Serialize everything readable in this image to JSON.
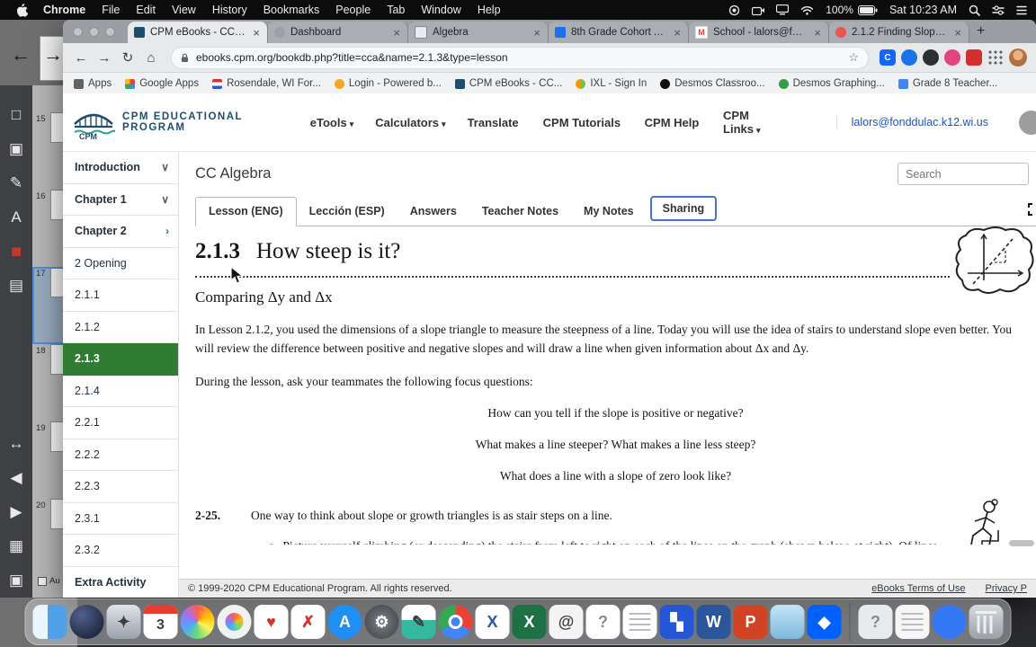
{
  "menubar": {
    "items": [
      {
        "label": "Chrome",
        "cls": "b"
      },
      {
        "label": "File"
      },
      {
        "label": "Edit"
      },
      {
        "label": "View"
      },
      {
        "label": "History"
      },
      {
        "label": "Bookmarks"
      },
      {
        "label": "People"
      },
      {
        "label": "Tab"
      },
      {
        "label": "Window"
      },
      {
        "label": "Help"
      }
    ],
    "battery": "100%",
    "clock": "Sat 10:23 AM"
  },
  "browser": {
    "tabs": [
      {
        "title": "CPM eBooks - CC Algeb...",
        "cls": "active",
        "fav": "background:#1d4e6b"
      },
      {
        "title": "Dashboard",
        "fav": "background:#9aa0a6;border-radius:50%"
      },
      {
        "title": "Algebra",
        "fav": "background:#e8eaed;border:1px solid #80868b"
      },
      {
        "title": "8th Grade Cohort A Wee...",
        "fav": "background:#1a73e8"
      },
      {
        "title": "School - lalors@fonddul...",
        "fav": "background:#ffffff;border:1px solid #ddd",
        "glyph": "M"
      },
      {
        "title": "2.1.2 Finding Slope CCA",
        "fav": "background:#e8564f;border-radius:50%"
      }
    ],
    "new_tab": "+",
    "url": "ebooks.cpm.org/bookdb.php?title=cca&name=2.1.3&type=lesson",
    "bookmarks": [
      {
        "label": "Apps",
        "fav": "background:#5f6368"
      },
      {
        "label": "Google Apps",
        "fav": "background:conic-gradient(#ea4335 0 25%,#4285f4 0 50%,#34a853 0 75%,#fbbc05 0)"
      },
      {
        "label": "Rosendale, WI For...",
        "fav": "background:linear-gradient(180deg,#cc3333 33%,#ffffff 33% 66%,#3355cc 66%)"
      },
      {
        "label": "Login - Powered b...",
        "fav": "background:#f5a623;border-radius:50%"
      },
      {
        "label": "CPM eBooks - CC...",
        "fav": "background:#1d4e6b"
      },
      {
        "label": "IXL - Sign In",
        "fav": "background:linear-gradient(90deg,#ff9900 50%,#7ac143 50%);border-radius:50%"
      },
      {
        "label": "Desmos Classroo...",
        "fav": "background:#111111;border-radius:50%"
      },
      {
        "label": "Desmos Graphing...",
        "fav": "background:#2f9e44;border-radius:50%"
      },
      {
        "label": "Grade 8 Teacher...",
        "fav": "background:#4285f4"
      }
    ]
  },
  "site": {
    "brand": "CPM EDUCATIONAL PROGRAM",
    "nav": [
      {
        "label": "eTools",
        "caret": "▾"
      },
      {
        "label": "Calculators",
        "caret": "▾"
      },
      {
        "label": "Translate",
        "caret": ""
      },
      {
        "label": "CPM Tutorials",
        "caret": ""
      },
      {
        "label": "CPM Help",
        "caret": ""
      },
      {
        "label": "CPM Links",
        "caret": "▾"
      }
    ],
    "account": "lalors@fonddulac.k12.wi.us"
  },
  "toc": [
    {
      "label": "Introduction",
      "cls": "chapter",
      "chev": "∨"
    },
    {
      "label": "Chapter 1",
      "cls": "chapter",
      "chev": "∨"
    },
    {
      "label": "Chapter 2",
      "cls": "chapter chev-green",
      "chev": "›"
    },
    {
      "label": "2 Opening"
    },
    {
      "label": "2.1.1"
    },
    {
      "label": "2.1.2"
    },
    {
      "label": "2.1.3",
      "cls": "selected"
    },
    {
      "label": "2.1.4"
    },
    {
      "label": "2.2.1"
    },
    {
      "label": "2.2.2"
    },
    {
      "label": "2.2.3"
    },
    {
      "label": "2.3.1"
    },
    {
      "label": "2.3.2"
    },
    {
      "label": "Extra Activity",
      "cls": "chapter"
    }
  ],
  "lesson": {
    "course": "CC Algebra",
    "search_placeholder": "Search",
    "tabs": [
      {
        "label": "Lesson (ENG)",
        "cls": "active"
      },
      {
        "label": "Lección (ESP)"
      },
      {
        "label": "Answers"
      },
      {
        "label": "Teacher Notes"
      },
      {
        "label": "My Notes"
      },
      {
        "label": "Sharing",
        "cls": "sharing"
      }
    ],
    "number": "2.1.3",
    "title": "How steep is it?",
    "subtitle": "Comparing Δy and Δx",
    "intro": "In Lesson 2.1.2, you used the dimensions of a slope triangle to measure the steepness of a line.  Today you will use the idea of stairs to understand slope even better.  You will review the difference between positive and negative slopes and will draw a line when given information about Δx and Δy.",
    "prompt": "During the lesson, ask your teammates the following focus questions:",
    "questions": [
      "How can you tell if the slope is positive or negative?",
      "What makes a line steeper?  What makes a line less steep?",
      "What does a line with a slope of zero look like?"
    ],
    "problem": {
      "number": "2-25.",
      "text": "One way to think about slope or growth triangles is as stair steps on a line.",
      "item_label": "a.",
      "item_a": "Picture yourself climbing (or descending) the stairs from left to right on each of the lines on the graph (shown below, at right).  Of lines A, B, and C, which is the steepest?  Which is the least steep?"
    }
  },
  "footer": {
    "copyright": "© 1999-2020 CPM Educational Program. All rights reserved.",
    "links": [
      "eBooks Terms of Use",
      "Privacy P"
    ]
  },
  "panel": {
    "pages": [
      {
        "n": "15"
      },
      {
        "n": "16"
      },
      {
        "n": "17",
        "cls": "sel"
      },
      {
        "n": "18"
      },
      {
        "n": "19"
      },
      {
        "n": "20"
      }
    ],
    "bottom_label": "Au",
    "tools_top": [
      {
        "name": "page-tool",
        "glyph": "□"
      },
      {
        "name": "image-tool",
        "glyph": "▣"
      },
      {
        "name": "pen-tool",
        "glyph": "✎"
      },
      {
        "name": "text-tool",
        "glyph": "A"
      },
      {
        "name": "color-swatch",
        "glyph": "■",
        "cls": "swatch"
      },
      {
        "name": "mini-pages",
        "glyph": "▤"
      }
    ],
    "tools_bottom": [
      {
        "name": "resize-tool",
        "glyph": "↔"
      },
      {
        "name": "prev-page",
        "glyph": "◀"
      },
      {
        "name": "next-page",
        "glyph": "▶"
      },
      {
        "name": "grid-tool",
        "glyph": "▦"
      },
      {
        "name": "export-tool",
        "glyph": "▣"
      }
    ]
  },
  "dock": {
    "apps": [
      {
        "name": "finder",
        "style": "background:linear-gradient(90deg,#eaf5fe 0 44%,#51a1e8 44%)"
      },
      {
        "name": "dark-globe-app",
        "style": "background:radial-gradient(circle at 35% 30%,#50618c,#12172b);border-radius:50%"
      },
      {
        "name": "launchpad",
        "glyph": "✦",
        "cls": "g-dark",
        "style": "background:linear-gradient(180deg,#e0e4e9,#98a1ab)"
      },
      {
        "name": "calendar",
        "glyph": "3",
        "cls": "cal g-dark",
        "style": "background:#ffffff"
      },
      {
        "name": "photos",
        "style": "background:conic-gradient(#ff5e57,#ffbb00,#fff35c,#69db7c,#4dabf7,#9775fa,#ff5e57);border-radius:50%"
      },
      {
        "name": "color-wheel",
        "style": "background:conic-gradient(#ff5e57,#ffbb00,#69db7c,#4dabf7,#9775fa,#ff5e57);border-radius:50%;box-shadow:inset 0 0 0 9px #f1f1f1"
      },
      {
        "name": "pin-app",
        "glyph": "♥",
        "cls": "g-red",
        "style": "background:#ffffff"
      },
      {
        "name": "red-x-app",
        "glyph": "✗",
        "cls": "g-red",
        "style": "background:#ffffff"
      },
      {
        "name": "app-store",
        "glyph": "A",
        "style": "background:#1f8ef5;border-radius:50%"
      },
      {
        "name": "system-preferences",
        "glyph": "⚙",
        "style": "background:radial-gradient(circle,#7d8187,#3a3d42);border-radius:50%"
      },
      {
        "name": "notes-app",
        "glyph": "✎",
        "cls": "g-dark",
        "style": "background:linear-gradient(180deg,#ffffff 45%,#35b8a0 45%)"
      },
      {
        "name": "chrome",
        "cls": "chrome",
        "style": "background:conic-gradient(#ea4335 0 120deg,#4285f4 120deg 240deg,#34a853 240deg 360deg);border-radius:50%"
      },
      {
        "name": "excel-doc",
        "glyph": "X",
        "cls": "g-blue",
        "style": "background:#ffffff"
      },
      {
        "name": "excel",
        "glyph": "X",
        "style": "background:#1e7145"
      },
      {
        "name": "spiral-app",
        "glyph": "@",
        "cls": "g-dark",
        "style": "background:#f4f4f4"
      },
      {
        "name": "missing-app",
        "glyph": "?",
        "cls": "g-gray",
        "style": "background:#ffffff"
      },
      {
        "name": "textedit",
        "cls": "lines",
        "style": "background:#ffffff"
      },
      {
        "name": "tiles-app",
        "glyph": "▚",
        "style": "background:#2456d6"
      },
      {
        "name": "word",
        "glyph": "W",
        "style": "background:#2b579a"
      },
      {
        "name": "powerpoint",
        "glyph": "P",
        "style": "background:#d04423"
      },
      {
        "name": "utility-app",
        "style": "background:linear-gradient(180deg,#c3e5f8,#7fb8da)"
      },
      {
        "name": "dropbox",
        "glyph": "◆",
        "style": "background:#0061ff"
      }
    ],
    "extras": [
      {
        "name": "help-doc",
        "glyph": "?",
        "cls": "g-gray",
        "style": "background:#e9eaec"
      },
      {
        "name": "document-stack",
        "cls": "lines",
        "style": "background:#f6f6f6"
      },
      {
        "name": "blue-folder",
        "style": "background:#3478f6;border-radius:50%"
      },
      {
        "name": "trash",
        "cls": "trash",
        "style": "background:linear-gradient(180deg,#d6dade,#9aa0a6)"
      }
    ]
  }
}
